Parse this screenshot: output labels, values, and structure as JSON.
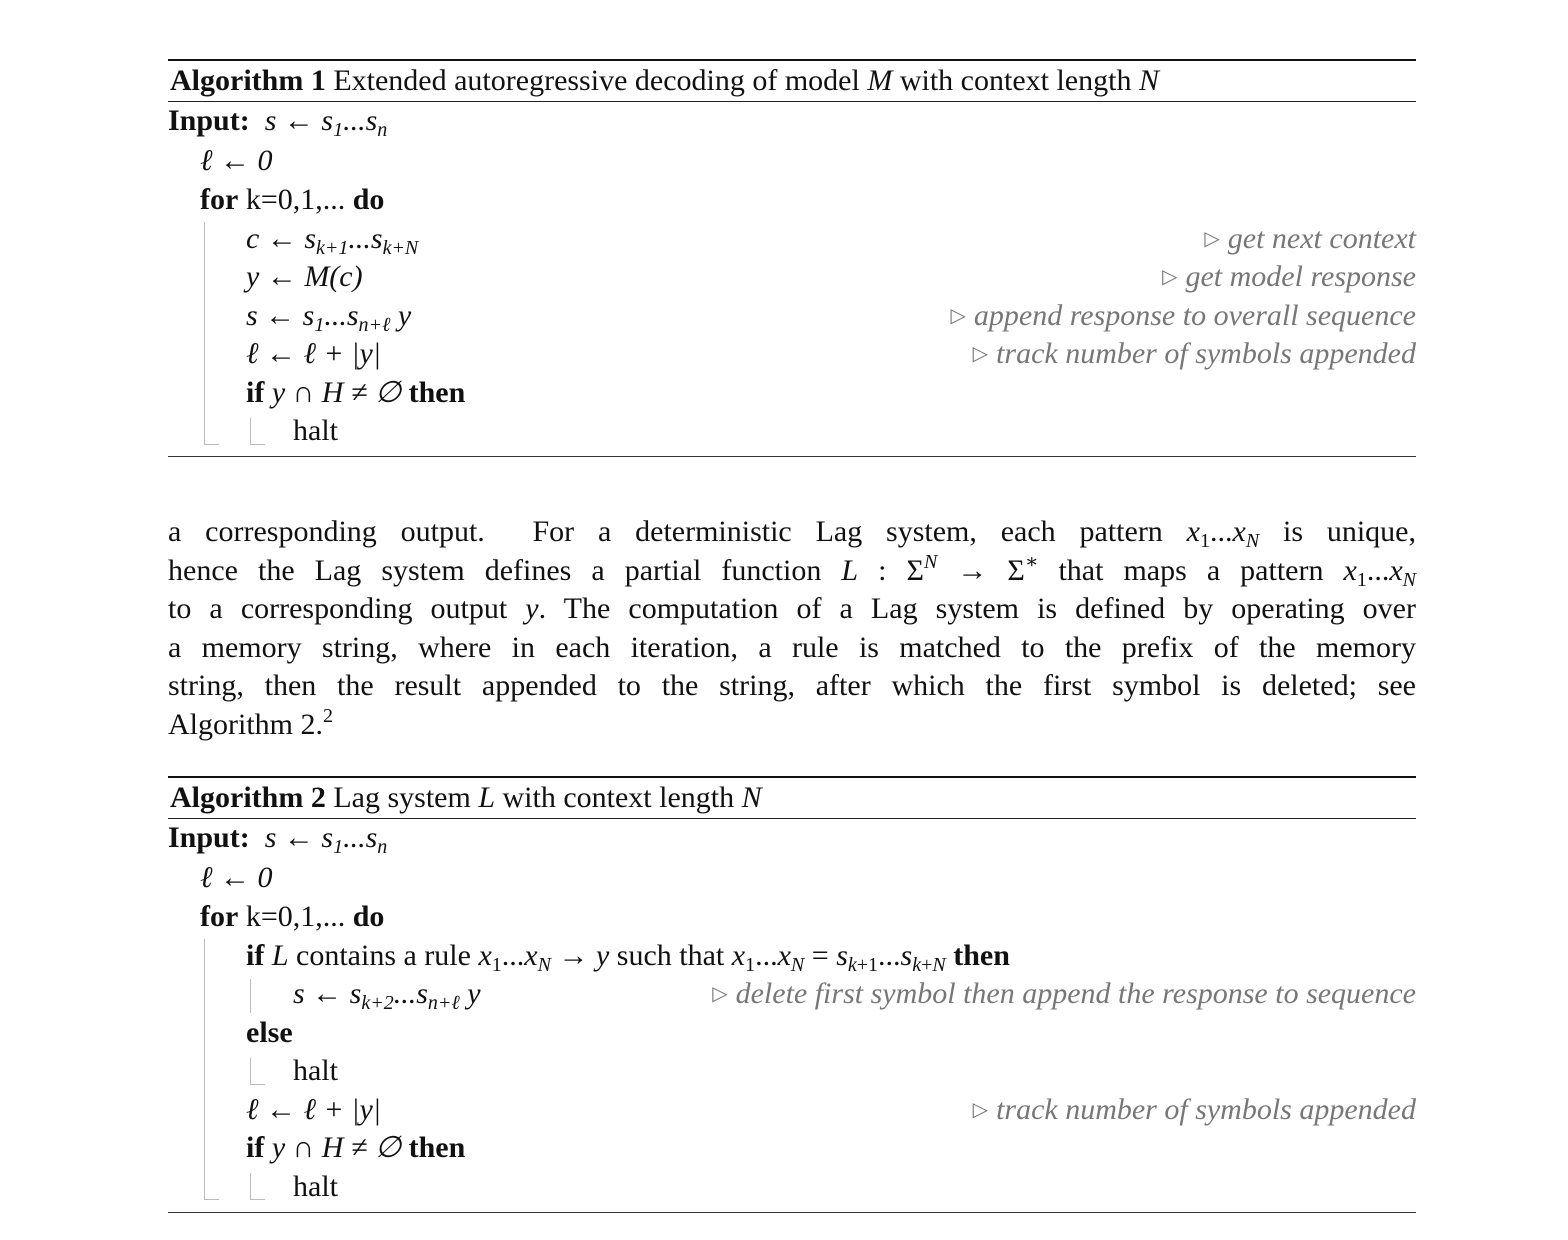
{
  "algorithm1": {
    "label": "Algorithm 1",
    "caption_parts": [
      "Extended autoregressive decoding of model ",
      "M",
      " with context length ",
      "N"
    ],
    "input_label": "Input:",
    "input_expr": "s ← s",
    "lines": {
      "init": "ℓ ← 0",
      "for_kw": "for",
      "for_range": " k=0,1,... ",
      "do_kw": "do",
      "assign_c": "c ← s",
      "assign_y": "y ← M(c)",
      "assign_s": "s ← s",
      "assign_l": "ℓ ← ℓ + |y|",
      "if_kw": "if",
      "if_cond": " y ∩ H ≠ ∅ ",
      "then_kw": "then",
      "halt": "halt"
    },
    "comments": {
      "c": "get next context",
      "y": "get model response",
      "s": "append response to overall sequence",
      "l": "track number of symbols appended"
    }
  },
  "paragraph": {
    "lines": [
      "a corresponding output.  For a deterministic Lag system, each pattern x₁...x_N is unique,",
      "hence the Lag system defines a partial function L : Σ^N → Σ* that maps a pattern x₁...x_N",
      "to a corresponding output y. The computation of a Lag system is defined by operating over",
      "a memory string, where in each iteration, a rule is matched to the prefix of the memory",
      "string, then the result appended to the string, after which the first symbol is deleted; see",
      "Algorithm 2.²"
    ],
    "footnote_marker": "2"
  },
  "algorithm2": {
    "label": "Algorithm 2",
    "caption_parts": [
      "Lag system ",
      "L",
      " with context length ",
      "N"
    ],
    "input_label": "Input:",
    "lines": {
      "init": "ℓ ← 0",
      "for_kw": "for",
      "for_range": " k=0,1,... ",
      "do_kw": "do",
      "if_kw": "if",
      "if_rule": " L contains a rule x",
      "then_kw": "then",
      "assign_s": "s ← s",
      "else_kw": "else",
      "halt": "halt",
      "assign_l": "ℓ ← ℓ + |y|",
      "if2_cond": " y ∩ H ≠ ∅ "
    },
    "comments": {
      "s": "delete first symbol then append the response to sequence",
      "l": "track number of symbols appended"
    }
  },
  "colors": {
    "text": "#111111",
    "comment": "#777777",
    "guide_lines": "#bbbbbb"
  }
}
